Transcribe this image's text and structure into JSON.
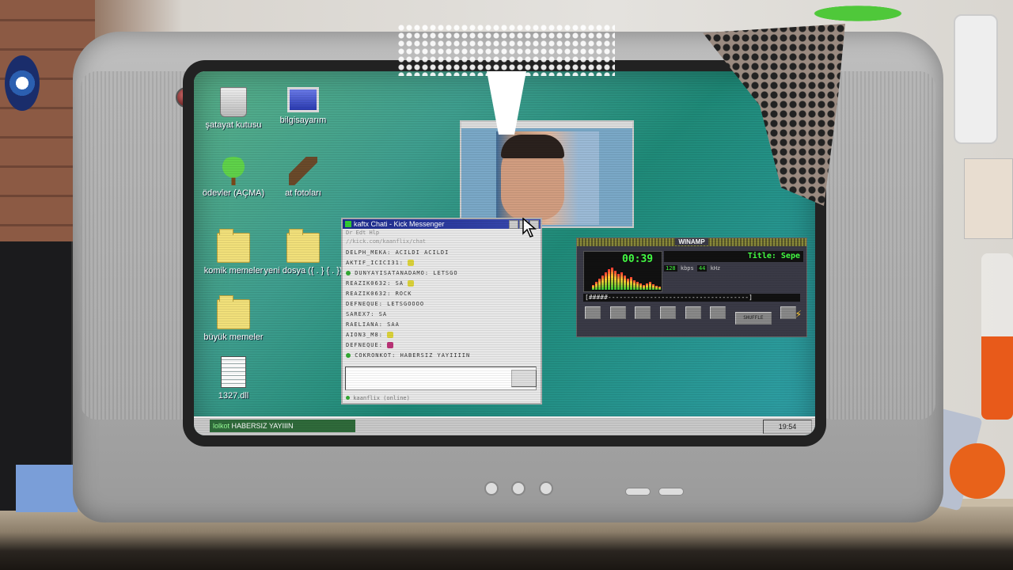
{
  "desktop": {
    "icons": [
      {
        "label": "şatayat kutusu",
        "icon": "recycle-bin-icon"
      },
      {
        "label": "bilgisayarım",
        "icon": "computer-icon"
      },
      {
        "label": "ödevler (AÇMA)",
        "icon": "tree-icon"
      },
      {
        "label": "at fotoları",
        "icon": "horse-icon"
      },
      {
        "label": "komik memeler",
        "icon": "folder-icon"
      },
      {
        "label": "yeni dosya ({ . } { . })",
        "icon": "folder-icon"
      },
      {
        "label": "büyük memeler",
        "icon": "folder-icon"
      },
      {
        "label": "1327.dll",
        "icon": "dll-file-icon"
      }
    ]
  },
  "chat_window": {
    "title": "kaftx Chati - Kick Messenger",
    "menu": "Dr  Edt  Hlp",
    "url": "//kick.com/kaanflix/chat",
    "messages": [
      "DELPH_MEKA: ACILDI ACILDI",
      "AKTIF_ICICI31:",
      "DUNYAYISATANADAMO: LETSGO",
      "REAZIK0632: SA",
      "REAZIK0632: ROCK",
      "DEFNEQUE: LETSGOOOO",
      "SAREX7: SA",
      "RAELIANA: SAA",
      "AION3_M8:",
      "DEFNEQUE:",
      "COKRONKOT: HABERSIZ YAYIIIIN"
    ],
    "status": "kaanflix (online)"
  },
  "winamp": {
    "title": "WINAMP",
    "time": "00:39",
    "track_title": "Title: Sepe",
    "kbps": "128",
    "kbps_label": "kbps",
    "khz": "44",
    "khz_label": "kHz",
    "seek_bar": "[#####-------------------------------------]",
    "shuffle_label": "SHUFFLE",
    "eq_levels": [
      6,
      10,
      14,
      18,
      22,
      26,
      28,
      24,
      20,
      22,
      18,
      14,
      16,
      12,
      10,
      8,
      6,
      8,
      10,
      7,
      5,
      4
    ]
  },
  "taskbar": {
    "task_user": "lolkot",
    "task_text": "HABERSIZ YAYIIIN",
    "clock": "19:54"
  }
}
